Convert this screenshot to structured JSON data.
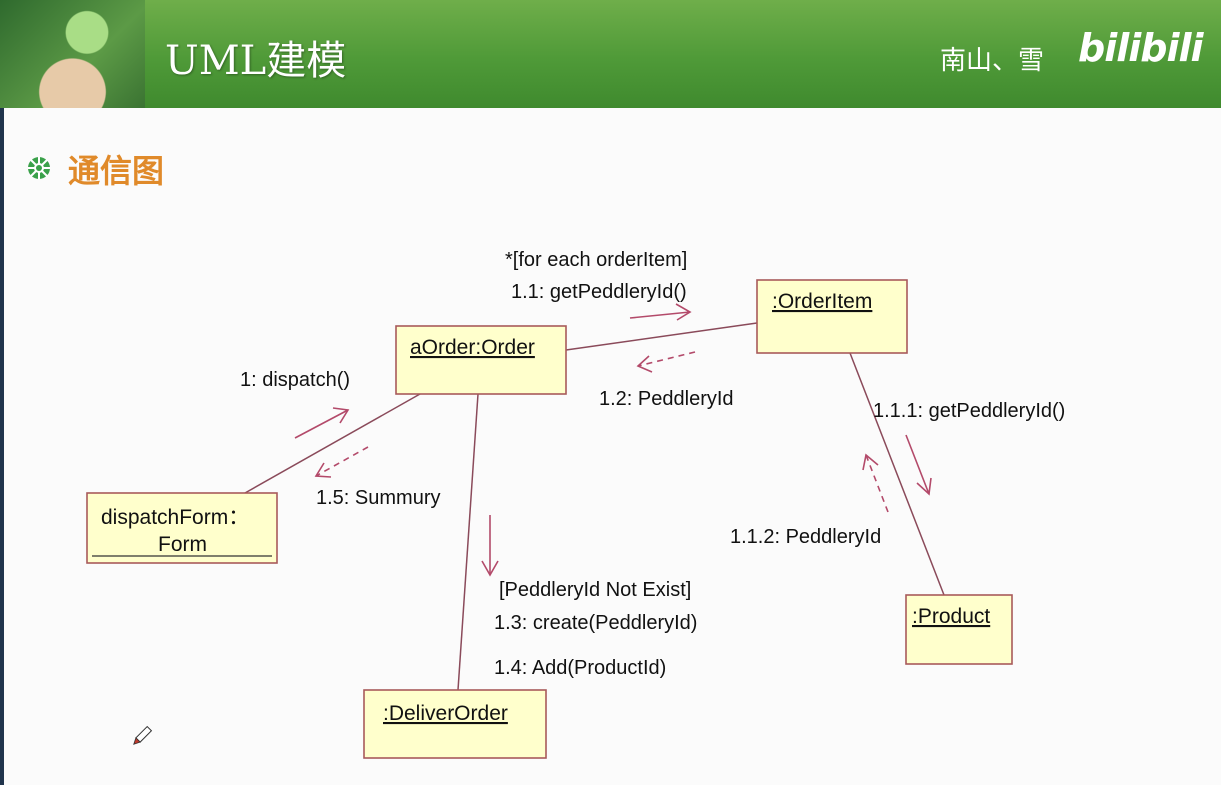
{
  "header": {
    "title": "UML建模",
    "author": "南山、雪",
    "brand": "bilibili"
  },
  "section": {
    "title": "通信图"
  },
  "diagram": {
    "objects": {
      "aorder": "aOrder:Order",
      "orderitem": ":OrderItem",
      "dispatchform_line1": "dispatchForm：",
      "dispatchform_line2": "Form",
      "product": ":Product",
      "deliverorder": ":DeliverOrder"
    },
    "messages": {
      "m1": "1: dispatch()",
      "m11_guard": "*[for each orderItem]",
      "m11": "1.1: getPeddleryId()",
      "m12": "1.2: PeddleryId",
      "m111": "1.1.1: getPeddleryId()",
      "m112": "1.1.2: PeddleryId",
      "m13_guard": "[PeddleryId Not Exist]",
      "m13": "1.3: create(PeddleryId)",
      "m14": "1.4: Add(ProductId)",
      "m15": "1.5: Summury"
    }
  }
}
